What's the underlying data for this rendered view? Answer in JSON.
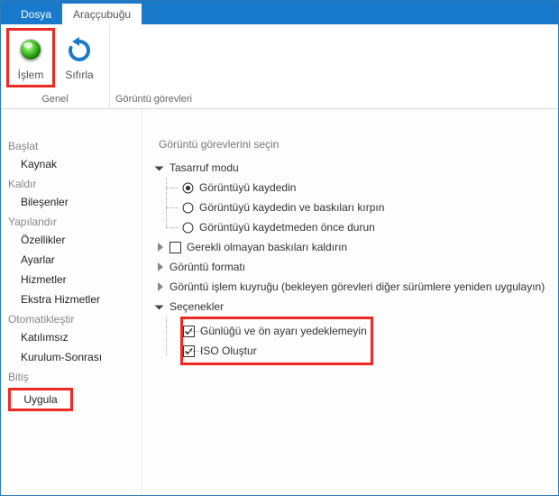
{
  "tabs": {
    "file": "Dosya",
    "toolbar": "Araççubuğu"
  },
  "ribbon": {
    "islem": "İşlem",
    "sifirla": "Sıfırla",
    "group_general": "Genel",
    "group_image_tasks": "Görüntü görevleri"
  },
  "sidebar": {
    "start": "Başlat",
    "source": "Kaynak",
    "remove": "Kaldır",
    "components": "Bileşenler",
    "configure": "Yapılandır",
    "features": "Özellikler",
    "settings": "Ayarlar",
    "services": "Hizmetler",
    "extras": "Ekstra Hizmetler",
    "automate": "Otomatikleştir",
    "unattended": "Katılımsız",
    "post_setup": "Kurulum-Sonrası",
    "finish": "Bitiş",
    "apply": "Uygula"
  },
  "content": {
    "title": "Görüntü görevlerini seçin",
    "save_mode": "Tasarruf modu",
    "radio_save": "Görüntüyü kaydedin",
    "radio_trim": "Görüntüyü kaydedin ve baskıları kırpın",
    "radio_stop": "Görüntüyü kaydetmeden önce durun",
    "remove_editions": "Gerekli olmayan baskıları kaldırın",
    "image_format": "Görüntü formatı",
    "process_queue": "Görüntü işlem kuyruğu (bekleyen görevleri diğer sürümlere yeniden uygulayın)",
    "options": "Seçenekler",
    "opt_backup": "Günlüğü ve ön ayarı yedeklemeyin",
    "opt_iso": "ISO Oluştur"
  }
}
